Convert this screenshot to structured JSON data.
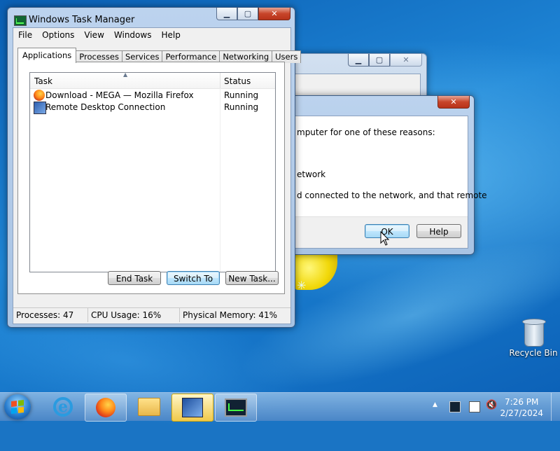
{
  "task_manager": {
    "title": "Windows Task Manager",
    "menu": [
      "File",
      "Options",
      "View",
      "Windows",
      "Help"
    ],
    "tabs": [
      "Applications",
      "Processes",
      "Services",
      "Performance",
      "Networking",
      "Users"
    ],
    "active_tab": "Applications",
    "columns": {
      "task": "Task",
      "status": "Status"
    },
    "rows": [
      {
        "task": "Download - MEGA — Mozilla Firefox",
        "status": "Running",
        "icon": "firefox-icon"
      },
      {
        "task": "Remote Desktop Connection",
        "status": "Running",
        "icon": "remote-desktop-icon"
      }
    ],
    "buttons": {
      "end_task": "End Task",
      "switch_to": "Switch To",
      "new_task": "New Task..."
    },
    "status": {
      "processes": "Processes: 47",
      "cpu": "CPU Usage: 16%",
      "memory": "Physical Memory: 41%"
    }
  },
  "dialog": {
    "lines": [
      "mputer for one of these reasons:",
      "etwork",
      "d connected to the network, and that remote"
    ],
    "ok_label": "OK",
    "help_label": "Help"
  },
  "desktop": {
    "recycle_bin": "Recycle Bin"
  },
  "taskbar": {
    "pinned": [
      "internet-explorer-icon",
      "firefox-icon",
      "folder-icon",
      "remote-desktop-icon",
      "task-manager-icon"
    ],
    "clock_time": "7:26 PM",
    "clock_date": "2/27/2024"
  },
  "colors": {
    "desktop": "#1a74c4",
    "window_frame": "#bcd3ee",
    "close_button": "#c7452a"
  }
}
